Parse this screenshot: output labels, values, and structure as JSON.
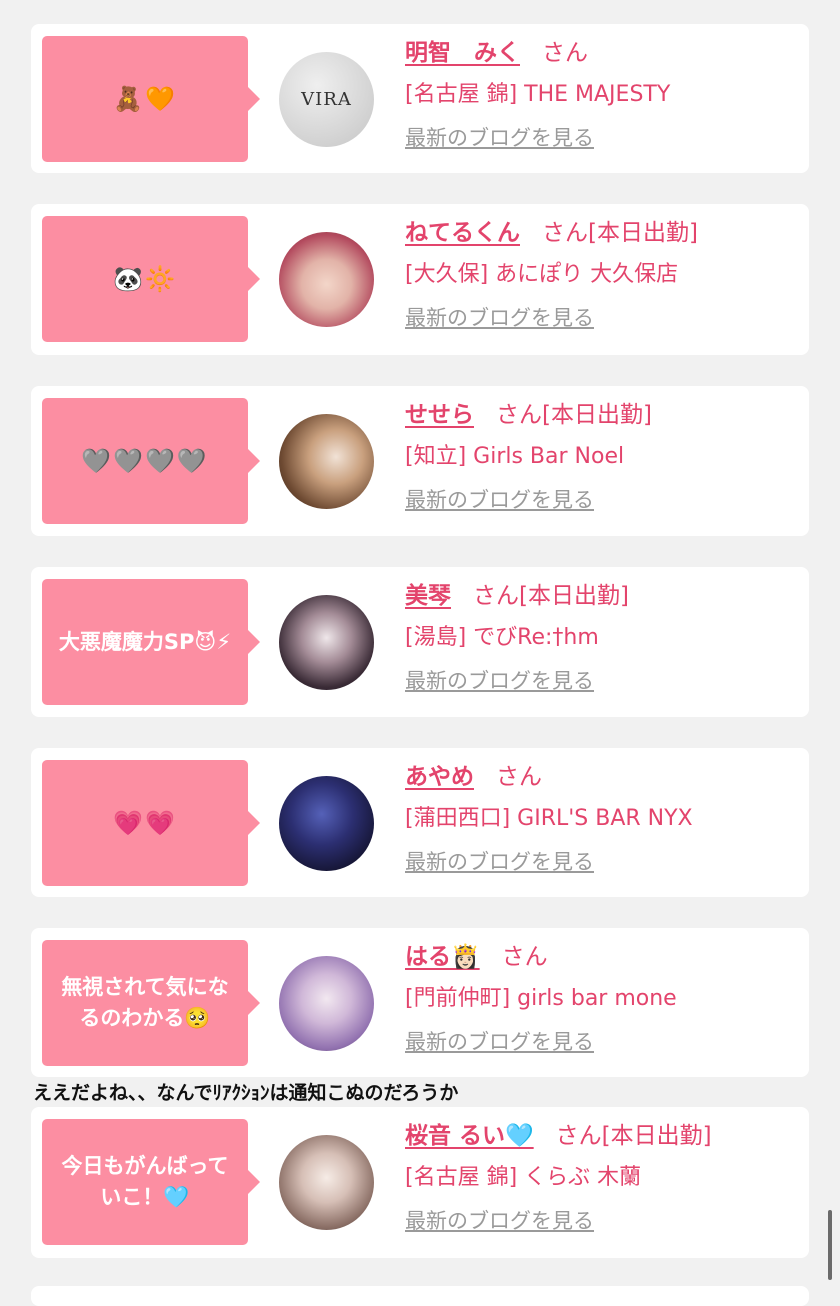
{
  "entries": [
    {
      "message": "🧸🧡",
      "name": "明智　みく",
      "honorific": "さん",
      "status": "",
      "shop": "[名古屋 錦] THE MAJESTY",
      "blog_link": "最新のブログを見る",
      "avatar_text": "VIRA"
    },
    {
      "message": "🐼🔆",
      "name": "ねてるくん",
      "honorific": "さん",
      "status": "[本日出勤]",
      "shop": "[大久保] あにぽり 大久保店",
      "blog_link": "最新のブログを見る"
    },
    {
      "message": "🩶🩶🩶🩶",
      "name": "せせら",
      "honorific": "さん",
      "status": "[本日出勤]",
      "shop": "[知立] Girls Bar Noel",
      "blog_link": "最新のブログを見る"
    },
    {
      "message": "大悪魔魔力SP😈⚡",
      "name": "美琴",
      "honorific": "さん",
      "status": "[本日出勤]",
      "shop": "[湯島] でびRe:†hm",
      "blog_link": "最新のブログを見る"
    },
    {
      "message": "💗💗",
      "name": "あやめ",
      "honorific": "さん",
      "status": "",
      "shop": "[蒲田西口] GIRL'S BAR NYX",
      "blog_link": "最新のブログを見る"
    },
    {
      "message": "無視されて気になるのわかる🥺",
      "name": "はる👸🏻",
      "honorific": "さん",
      "status": "",
      "shop": "[門前仲町] girls bar mone",
      "blog_link": "最新のブログを見る"
    },
    {
      "message": "今日もがんばっていこ！🩵",
      "name": "桜音 るい🩵",
      "honorific": "さん",
      "status": "[本日出勤]",
      "shop": "[名古屋 錦] くらぶ 木蘭",
      "blog_link": "最新のブログを見る"
    }
  ],
  "overlay_comment": "ええだよね、、なんでﾘｱｸｼｮﾝは通知こぬのだろうか",
  "colors": {
    "bubble": "#fc8ea2",
    "accent": "#e3446c",
    "link_gray": "#9a9a9a",
    "background": "#f1f1f1"
  }
}
